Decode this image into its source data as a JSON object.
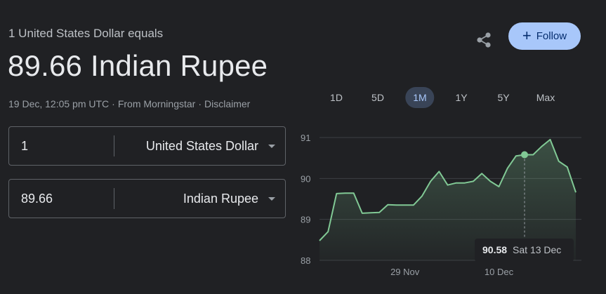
{
  "header": {
    "subtitle": "1 United States Dollar equals",
    "rate_text": "89.66 Indian Rupee",
    "timestamp": "19 Dec, 12:05 pm UTC",
    "source": "From Morningstar",
    "separator": "·",
    "disclaimer": "Disclaimer"
  },
  "converter": {
    "from": {
      "amount": "1",
      "currency": "United States Dollar"
    },
    "to": {
      "amount": "89.66",
      "currency": "Indian Rupee"
    }
  },
  "actions": {
    "share_icon": "share-icon",
    "follow_label": "Follow",
    "follow_icon": "plus-icon"
  },
  "range_tabs": [
    {
      "label": "1D",
      "active": false
    },
    {
      "label": "5D",
      "active": false
    },
    {
      "label": "1M",
      "active": true
    },
    {
      "label": "1Y",
      "active": false
    },
    {
      "label": "5Y",
      "active": false
    },
    {
      "label": "Max",
      "active": false
    }
  ],
  "tooltip": {
    "value": "90.58",
    "date": "Sat 13 Dec"
  },
  "colors": {
    "background": "#202124",
    "line": "#81c995",
    "follow_bg": "#a8c7fa",
    "active_tab_bg": "#394457",
    "active_tab_text": "#a8c7fa"
  },
  "chart_data": {
    "type": "area",
    "x_domain": [
      "2025-11-19",
      "2025-12-19"
    ],
    "ylim": [
      88,
      91
    ],
    "yticks": [
      88,
      89,
      90,
      91
    ],
    "xticks": [
      {
        "date": "2025-11-29",
        "label": "29 Nov"
      },
      {
        "date": "2025-12-10",
        "label": "10 Dec"
      }
    ],
    "grid": true,
    "highlight": {
      "date": "2025-12-13",
      "value": 90.58
    },
    "series": [
      {
        "values": [
          {
            "x": "2025-11-19",
            "y": 88.48
          },
          {
            "x": "2025-11-20",
            "y": 88.7
          },
          {
            "x": "2025-11-21",
            "y": 89.63
          },
          {
            "x": "2025-11-22",
            "y": 89.64
          },
          {
            "x": "2025-11-23",
            "y": 89.64
          },
          {
            "x": "2025-11-24",
            "y": 89.15
          },
          {
            "x": "2025-11-25",
            "y": 89.16
          },
          {
            "x": "2025-11-26",
            "y": 89.17
          },
          {
            "x": "2025-11-27",
            "y": 89.36
          },
          {
            "x": "2025-11-28",
            "y": 89.35
          },
          {
            "x": "2025-11-29",
            "y": 89.35
          },
          {
            "x": "2025-11-30",
            "y": 89.35
          },
          {
            "x": "2025-12-01",
            "y": 89.57
          },
          {
            "x": "2025-12-02",
            "y": 89.93
          },
          {
            "x": "2025-12-03",
            "y": 90.17
          },
          {
            "x": "2025-12-04",
            "y": 89.84
          },
          {
            "x": "2025-12-05",
            "y": 89.89
          },
          {
            "x": "2025-12-06",
            "y": 89.89
          },
          {
            "x": "2025-12-07",
            "y": 89.93
          },
          {
            "x": "2025-12-08",
            "y": 90.12
          },
          {
            "x": "2025-12-09",
            "y": 89.93
          },
          {
            "x": "2025-12-10",
            "y": 89.8
          },
          {
            "x": "2025-12-11",
            "y": 90.25
          },
          {
            "x": "2025-12-12",
            "y": 90.55
          },
          {
            "x": "2025-12-13",
            "y": 90.58
          },
          {
            "x": "2025-12-14",
            "y": 90.58
          },
          {
            "x": "2025-12-15",
            "y": 90.78
          },
          {
            "x": "2025-12-16",
            "y": 90.95
          },
          {
            "x": "2025-12-17",
            "y": 90.42
          },
          {
            "x": "2025-12-18",
            "y": 90.28
          },
          {
            "x": "2025-12-19",
            "y": 89.66
          }
        ]
      }
    ]
  }
}
